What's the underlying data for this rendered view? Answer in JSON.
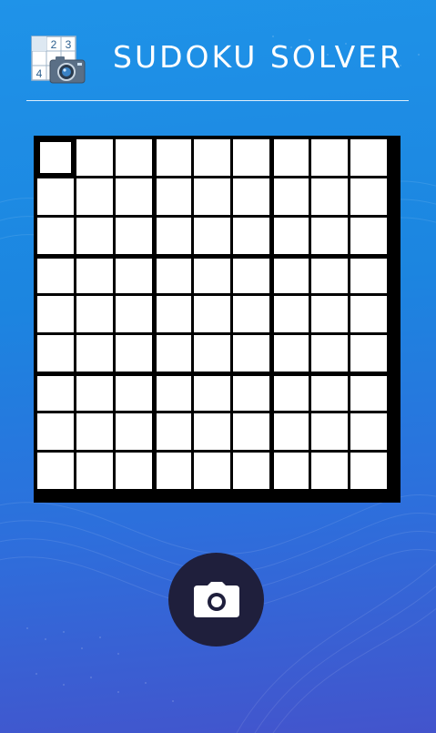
{
  "app": {
    "title": "SUDOKU SOLVER"
  },
  "logo": {
    "digits": [
      "2",
      "3",
      "4"
    ]
  },
  "board": {
    "size": 9,
    "selected_cell": {
      "row": 0,
      "col": 0
    },
    "cells": [
      [
        "",
        "",
        "",
        "",
        "",
        "",
        "",
        "",
        ""
      ],
      [
        "",
        "",
        "",
        "",
        "",
        "",
        "",
        "",
        ""
      ],
      [
        "",
        "",
        "",
        "",
        "",
        "",
        "",
        "",
        ""
      ],
      [
        "",
        "",
        "",
        "",
        "",
        "",
        "",
        "",
        ""
      ],
      [
        "",
        "",
        "",
        "",
        "",
        "",
        "",
        "",
        ""
      ],
      [
        "",
        "",
        "",
        "",
        "",
        "",
        "",
        "",
        ""
      ],
      [
        "",
        "",
        "",
        "",
        "",
        "",
        "",
        "",
        ""
      ],
      [
        "",
        "",
        "",
        "",
        "",
        "",
        "",
        "",
        ""
      ],
      [
        "",
        "",
        "",
        "",
        "",
        "",
        "",
        "",
        ""
      ]
    ]
  },
  "camera_button": {
    "icon": "camera-icon"
  },
  "colors": {
    "background_top": "#1f93e8",
    "background_bottom": "#4354cc",
    "camera_button": "#1f1f3c",
    "grid_lines": "#000000",
    "cell": "#ffffff"
  }
}
